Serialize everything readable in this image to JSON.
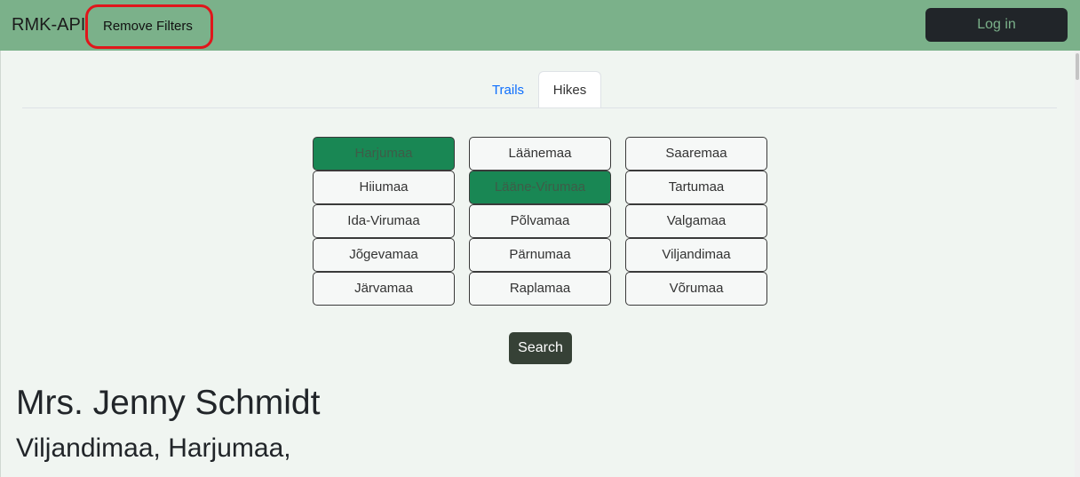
{
  "navbar": {
    "brand": "RMK-API",
    "remove_filters_label": "Remove Filters",
    "login_label": "Log in",
    "highlight_color": "#e0161b",
    "background_color": "#7bb18a"
  },
  "tabs": [
    {
      "label": "Trails",
      "active": false
    },
    {
      "label": "Hikes",
      "active": true
    }
  ],
  "counties": [
    [
      {
        "label": "Harjumaa",
        "selected": true
      },
      {
        "label": "Hiiumaa",
        "selected": false
      },
      {
        "label": "Ida-Virumaa",
        "selected": false
      },
      {
        "label": "Jõgevamaa",
        "selected": false
      },
      {
        "label": "Järvamaa",
        "selected": false
      }
    ],
    [
      {
        "label": "Läänemaa",
        "selected": false
      },
      {
        "label": "Lääne-Virumaa",
        "selected": true
      },
      {
        "label": "Põlvamaa",
        "selected": false
      },
      {
        "label": "Pärnumaa",
        "selected": false
      },
      {
        "label": "Raplamaa",
        "selected": false
      }
    ],
    [
      {
        "label": "Saaremaa",
        "selected": false
      },
      {
        "label": "Tartumaa",
        "selected": false
      },
      {
        "label": "Valgamaa",
        "selected": false
      },
      {
        "label": "Viljandimaa",
        "selected": false
      },
      {
        "label": "Võrumaa",
        "selected": false
      }
    ]
  ],
  "selected_color": "#198754",
  "search_label": "Search",
  "result": {
    "name": "Mrs. Jenny Schmidt",
    "counties": "Viljandimaa,  Harjumaa,"
  }
}
